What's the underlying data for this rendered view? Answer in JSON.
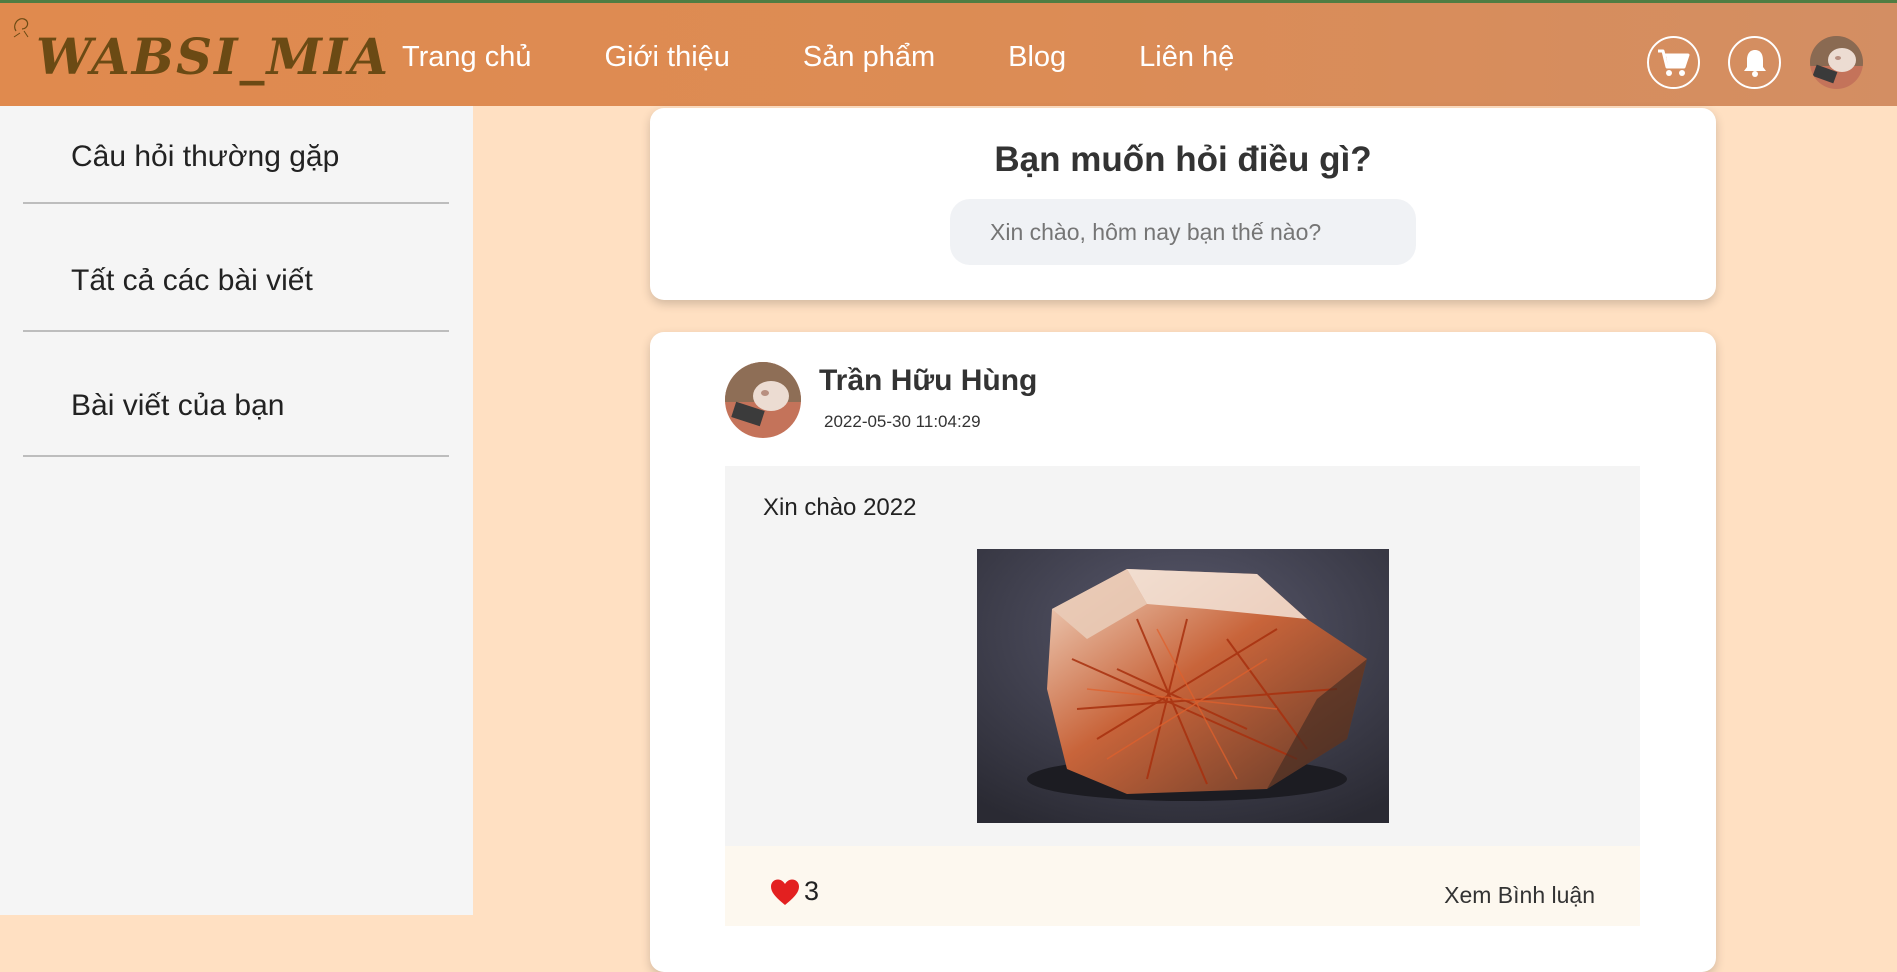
{
  "header": {
    "logo": "WABSI_MIA",
    "nav": [
      "Trang chủ",
      "Giới thiệu",
      "Sản phẩm",
      "Blog",
      "Liên hệ"
    ],
    "icons": [
      "cart-icon",
      "bell-icon",
      "user-avatar"
    ]
  },
  "sidebar": {
    "items": [
      {
        "label": "Câu hỏi thường gặp"
      },
      {
        "label": "Tất cả các bài viết"
      },
      {
        "label": "Bài viết của bạn"
      }
    ]
  },
  "ask": {
    "title": "Bạn muốn hỏi điều gì?",
    "placeholder": "Xin chào, hôm nay bạn thế nào?"
  },
  "post": {
    "author": "Trần Hữu Hùng",
    "timestamp": "2022-05-30 11:04:29",
    "text": "Xin chào 2022",
    "likes": "3",
    "comments_label": "Xem Bình luận",
    "image": "rutilated-quartz-photo"
  },
  "colors": {
    "header": "#e08a4e",
    "logo": "#6b4a14",
    "page_bg": "#ffe0c2",
    "sidebar_bg": "#f5f5f5",
    "heart": "#e32020"
  }
}
